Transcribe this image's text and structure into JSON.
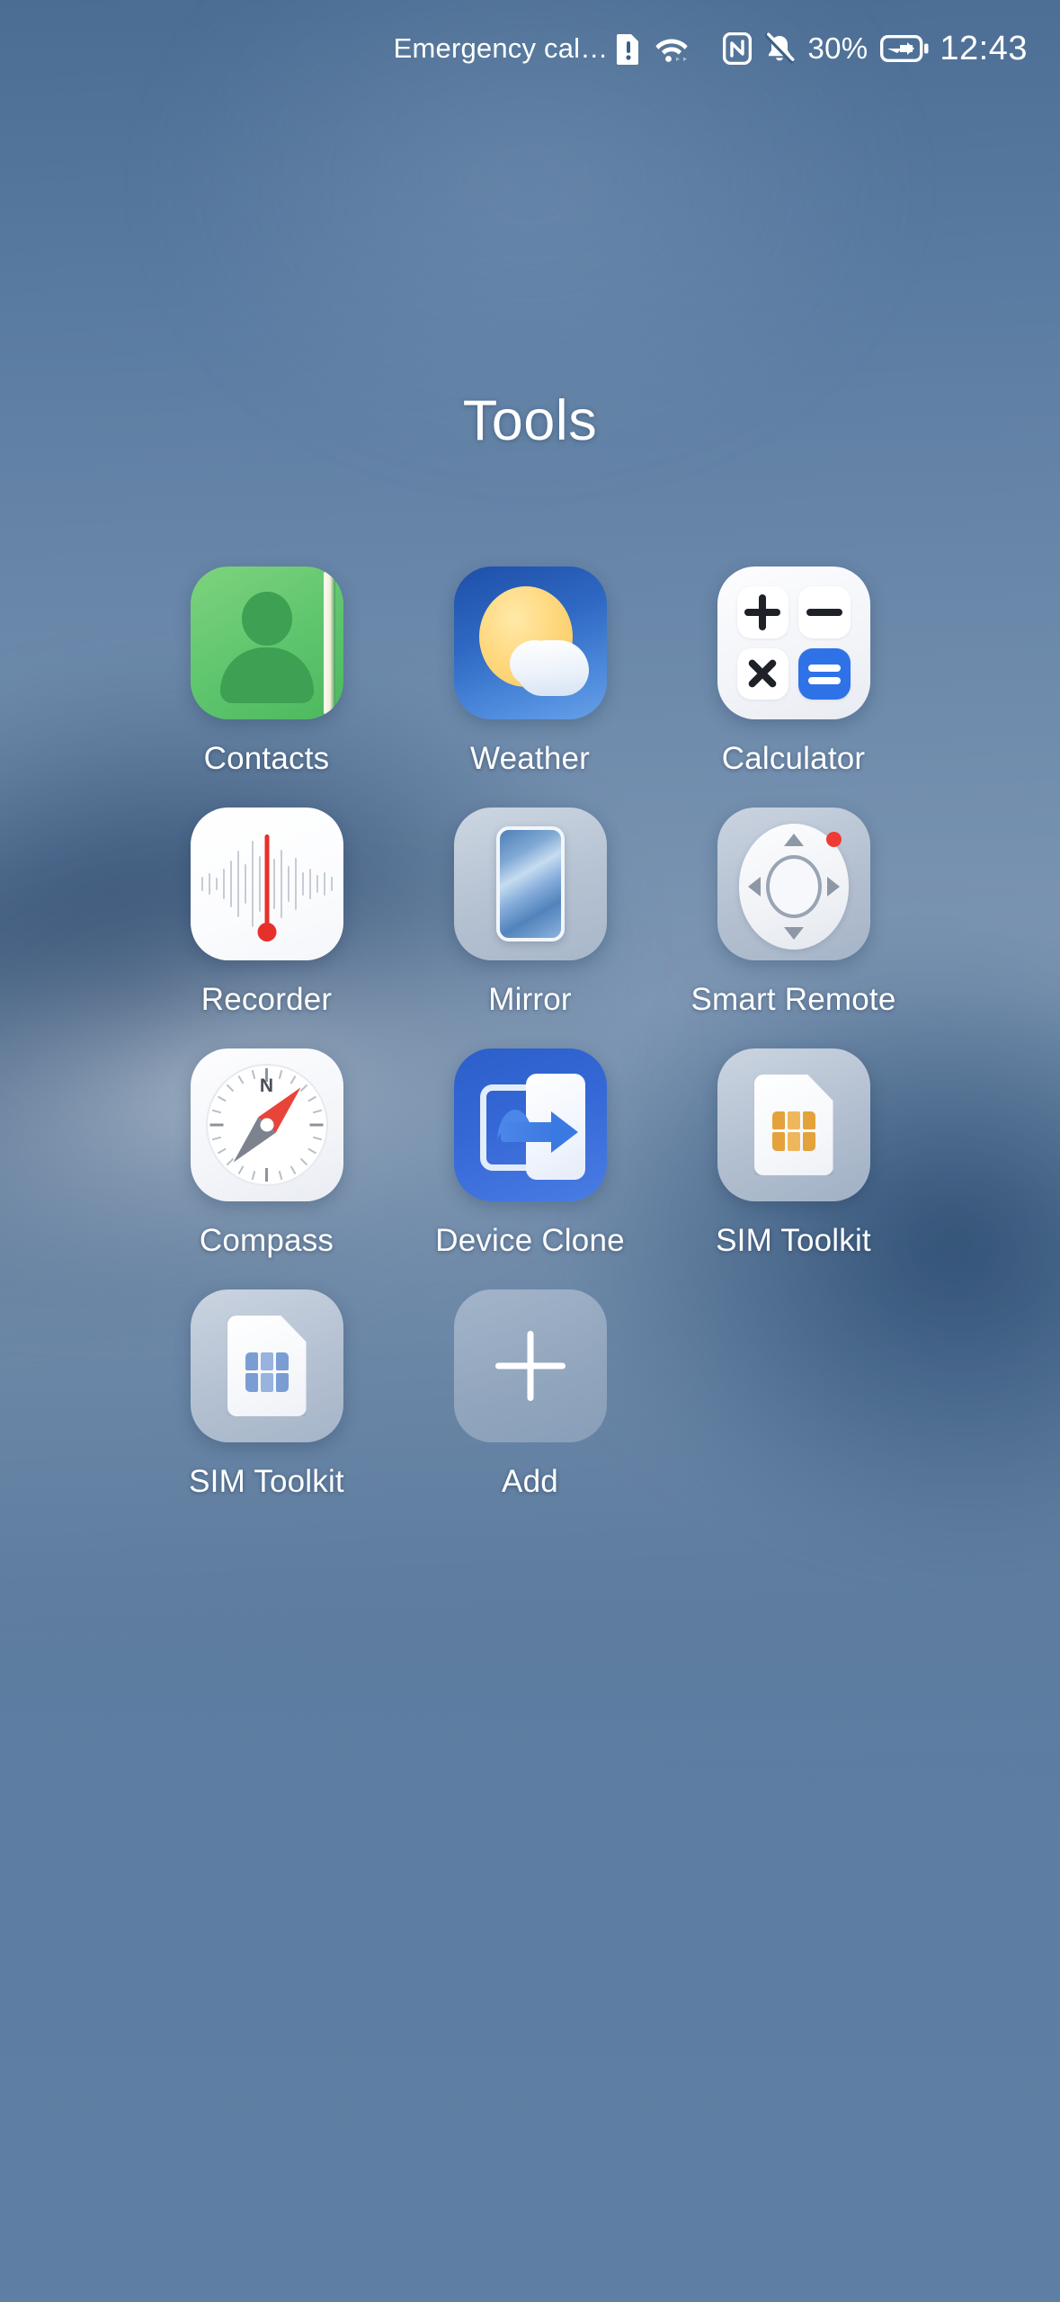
{
  "status_bar": {
    "carrier_text": "Emergency cal…",
    "sim_alert_icon": "sim-alert-icon",
    "wifi_icon": "wifi-icon",
    "nfc_icon": "nfc-icon",
    "mute_icon": "bell-muted-icon",
    "battery_percent": "30%",
    "battery_icon": "battery-charging-icon",
    "time": "12:43"
  },
  "folder": {
    "title": "Tools"
  },
  "apps": [
    {
      "label": "Contacts",
      "icon": "contacts-icon"
    },
    {
      "label": "Weather",
      "icon": "weather-icon"
    },
    {
      "label": "Calculator",
      "icon": "calculator-icon"
    },
    {
      "label": "Recorder",
      "icon": "recorder-icon"
    },
    {
      "label": "Mirror",
      "icon": "mirror-icon"
    },
    {
      "label": "Smart Remote",
      "icon": "smart-remote-icon"
    },
    {
      "label": "Compass",
      "icon": "compass-icon"
    },
    {
      "label": "Device Clone",
      "icon": "device-clone-icon"
    },
    {
      "label": "SIM Toolkit",
      "icon": "sim-toolkit-icon"
    },
    {
      "label": "SIM Toolkit",
      "icon": "sim-toolkit-icon"
    },
    {
      "label": "Add",
      "icon": "plus-icon"
    }
  ],
  "calculator_keys": [
    "+",
    "−",
    "×",
    "="
  ],
  "compass": {
    "north_label": "N"
  },
  "colors": {
    "background_blue": "#5c7da1",
    "background_deep": "#1e3a5f",
    "contacts_green": "#5cc46c",
    "weather_blue": "#2f69c4",
    "weather_sun": "#ffd87e",
    "calculator_accent": "#2f72e8",
    "recorder_red": "#e8302a",
    "remote_led_red": "#ef3b33",
    "compass_needle_red": "#e8443a",
    "compass_needle_gray": "#7c838f",
    "device_clone_blue": "#3568d6",
    "sim_chip_gold": "#e3a23c",
    "sim_chip_blue": "#7a9dd4",
    "label_white": "#ffffff"
  }
}
